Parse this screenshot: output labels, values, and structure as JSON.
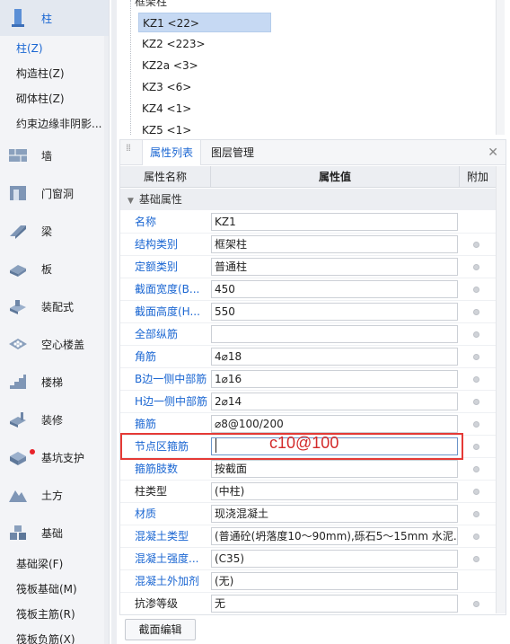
{
  "sidebar": {
    "top_category": "柱",
    "column_subitems": [
      "柱(Z)",
      "构造柱(Z)",
      "砌体柱(Z)",
      "约束边缘非阴影..."
    ],
    "categories": [
      {
        "label": "墙",
        "icon": "wall-icon"
      },
      {
        "label": "门窗洞",
        "icon": "door-window-icon"
      },
      {
        "label": "梁",
        "icon": "beam-icon"
      },
      {
        "label": "板",
        "icon": "slab-icon"
      },
      {
        "label": "装配式",
        "icon": "prefab-icon"
      },
      {
        "label": "空心楼盖",
        "icon": "hollow-floor-icon"
      },
      {
        "label": "楼梯",
        "icon": "stair-icon"
      },
      {
        "label": "装修",
        "icon": "decoration-icon"
      },
      {
        "label": "基坑支护",
        "icon": "pit-support-icon"
      },
      {
        "label": "土方",
        "icon": "earthwork-icon"
      },
      {
        "label": "基础",
        "icon": "foundation-icon"
      }
    ],
    "foundation_subitems": [
      "基础梁(F)",
      "筏板基础(M)",
      "筏板主筋(R)",
      "筏板负筋(X)"
    ]
  },
  "tree": {
    "root_label": "框架柱",
    "items": [
      "KZ1 <22>",
      "KZ2 <223>",
      "KZ2a <3>",
      "KZ3 <6>",
      "KZ4 <1>",
      "KZ5 <1>"
    ],
    "selected_index": 0
  },
  "panel": {
    "tabs": [
      "属性列表",
      "图层管理"
    ],
    "columns": {
      "name": "属性名称",
      "value": "属性值",
      "extra": "附加"
    },
    "group_label": "基础属性",
    "rows": [
      {
        "name": "名称",
        "value": "KZ1",
        "blue": true,
        "radio": false
      },
      {
        "name": "结构类别",
        "value": "框架柱",
        "blue": true,
        "radio": true
      },
      {
        "name": "定额类别",
        "value": "普通柱",
        "blue": true,
        "radio": true
      },
      {
        "name": "截面宽度(B...",
        "value": "450",
        "blue": true,
        "radio": true
      },
      {
        "name": "截面高度(H...",
        "value": "550",
        "blue": true,
        "radio": true
      },
      {
        "name": "全部纵筋",
        "value": "",
        "blue": true,
        "radio": true
      },
      {
        "name": "角筋",
        "value": "4⌀18",
        "blue": true,
        "radio": true
      },
      {
        "name": "B边一侧中部筋",
        "value": "1⌀16",
        "blue": true,
        "radio": true
      },
      {
        "name": "H边一侧中部筋",
        "value": "2⌀14",
        "blue": true,
        "radio": true
      },
      {
        "name": "箍筋",
        "value": "⌀8@100/200",
        "blue": true,
        "radio": true
      },
      {
        "name": "节点区箍筋",
        "value": "",
        "blue": true,
        "radio": true
      },
      {
        "name": "箍筋肢数",
        "value": "按截面",
        "blue": true,
        "radio": true
      },
      {
        "name": "柱类型",
        "value": "(中柱)",
        "blue": false,
        "radio": true
      },
      {
        "name": "材质",
        "value": "现浇混凝土",
        "blue": true,
        "radio": true
      },
      {
        "name": "混凝土类型",
        "value": "(普通砼(坍落度10～90mm),砾石5～15mm 水泥...",
        "blue": true,
        "radio": true
      },
      {
        "name": "混凝土强度...",
        "value": "(C35)",
        "blue": true,
        "radio": true
      },
      {
        "name": "混凝土外加剂",
        "value": "(无)",
        "blue": true,
        "radio": false
      },
      {
        "name": "抗渗等级",
        "value": "无",
        "blue": false,
        "radio": true
      }
    ],
    "typed_value": "c10@100",
    "bottom_button": "截面编辑"
  }
}
